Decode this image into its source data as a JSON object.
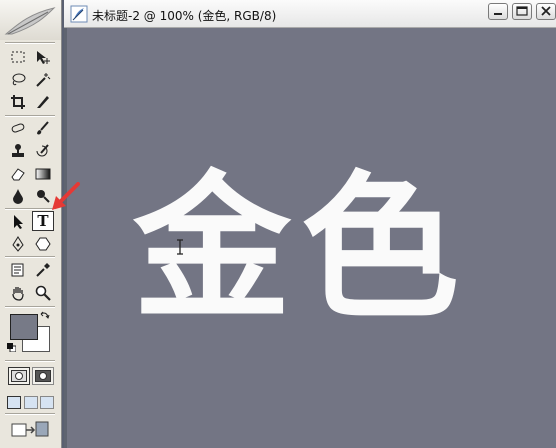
{
  "document": {
    "title": "未标题-2 @ 100% (金色, RGB/8)"
  },
  "canvas": {
    "text": "金色",
    "background_color": "#737584",
    "text_color": "#fafafa"
  },
  "toolbox": {
    "active_tool": "type-tool",
    "active_tool_glyph": "T",
    "foreground_color": "#777a87",
    "background_color": "#ffffff"
  },
  "annotation": {
    "arrow_color": "#e53935"
  }
}
